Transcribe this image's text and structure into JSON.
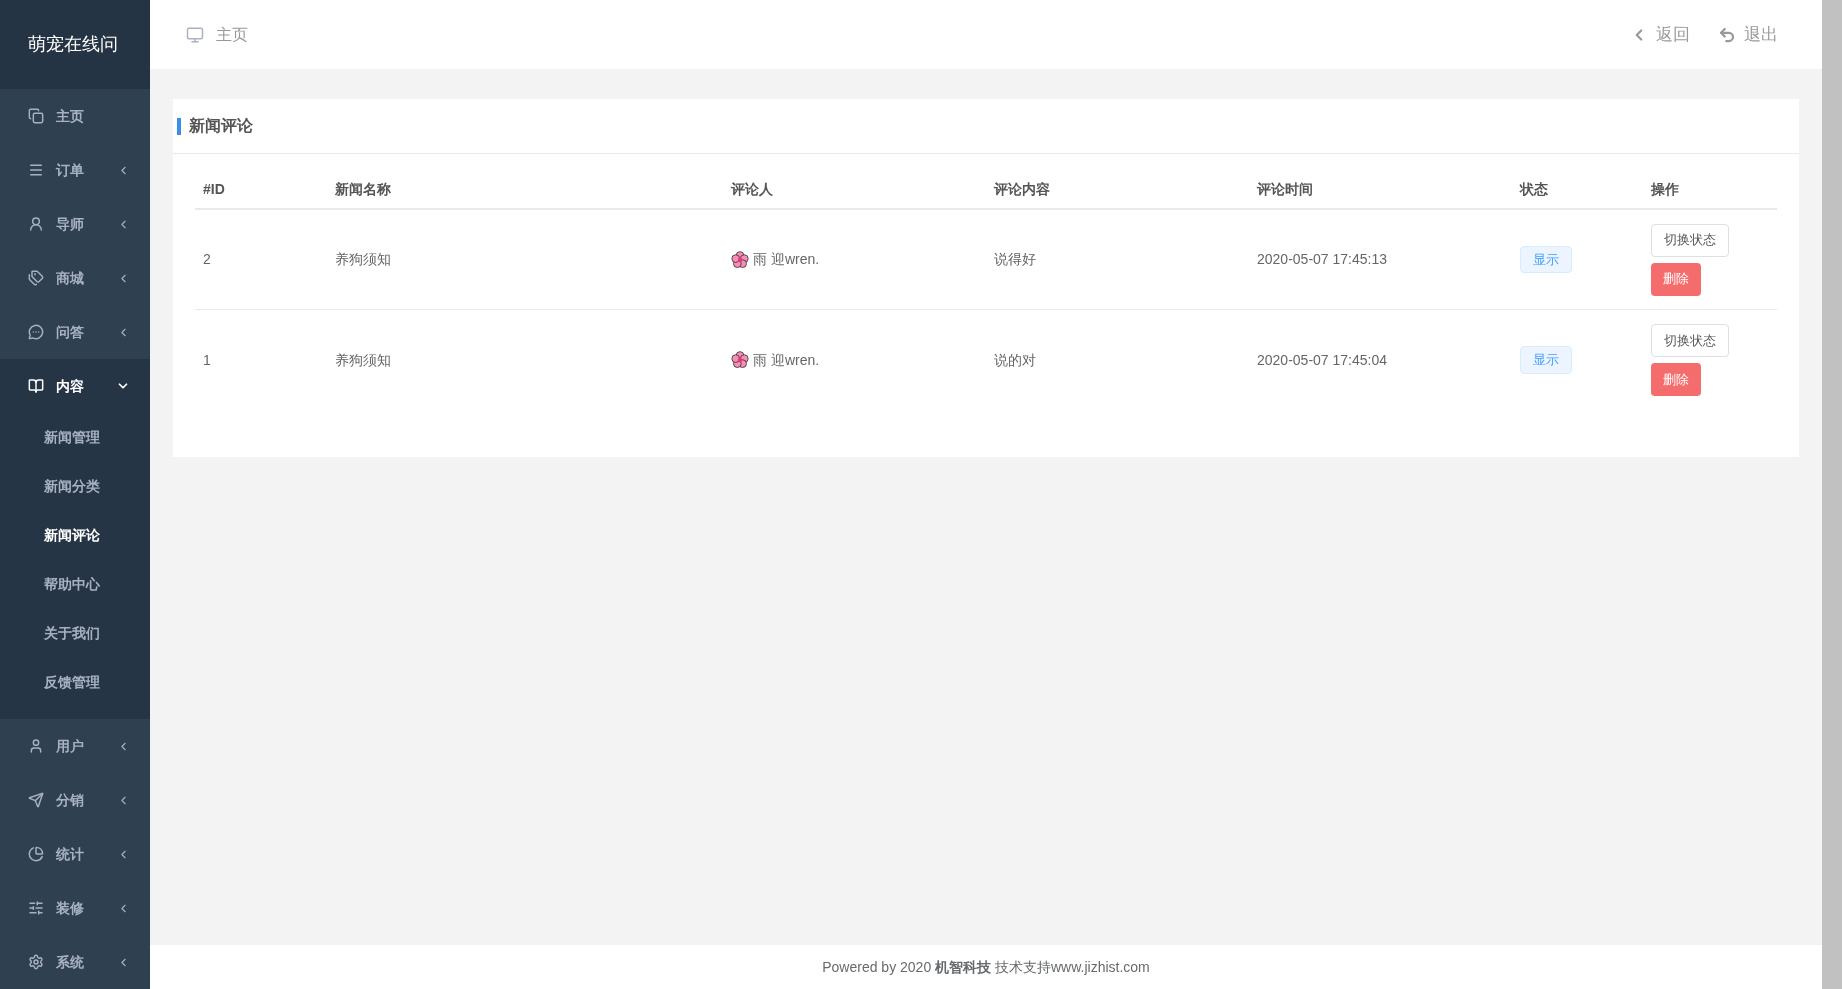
{
  "logo": "萌宠在线问",
  "sidebar": {
    "items": [
      {
        "label": "主页",
        "kind": "link"
      },
      {
        "label": "订单",
        "kind": "group",
        "expanded": false
      },
      {
        "label": "导师",
        "kind": "group",
        "expanded": false
      },
      {
        "label": "商城",
        "kind": "group",
        "expanded": false
      },
      {
        "label": "问答",
        "kind": "group",
        "expanded": false
      },
      {
        "label": "内容",
        "kind": "group",
        "expanded": true,
        "children": [
          {
            "label": "新闻管理",
            "selected": false
          },
          {
            "label": "新闻分类",
            "selected": false
          },
          {
            "label": "新闻评论",
            "selected": true
          },
          {
            "label": "帮助中心",
            "selected": false
          },
          {
            "label": "关于我们",
            "selected": false
          },
          {
            "label": "反馈管理",
            "selected": false
          }
        ]
      },
      {
        "label": "用户",
        "kind": "group",
        "expanded": false
      },
      {
        "label": "分销",
        "kind": "group",
        "expanded": false
      },
      {
        "label": "统计",
        "kind": "group",
        "expanded": false
      },
      {
        "label": "装修",
        "kind": "group",
        "expanded": false
      },
      {
        "label": "系统",
        "kind": "group",
        "expanded": false
      }
    ]
  },
  "header": {
    "breadcrumb": "主页",
    "back": "返回",
    "logout": "退出"
  },
  "card": {
    "title": "新闻评论",
    "table": {
      "columns": [
        "#ID",
        "新闻名称",
        "评论人",
        "评论内容",
        "评论时间",
        "状态",
        "操作"
      ],
      "rows": [
        {
          "id": "2",
          "news": "养狗须知",
          "commenter": "雨 迎wren.",
          "content": "说得好",
          "time": "2020-05-07 17:45:13",
          "status": "显示",
          "actions": [
            "切换状态",
            "删除"
          ]
        },
        {
          "id": "1",
          "news": "养狗须知",
          "commenter": "雨 迎wren.",
          "content": "说的对",
          "time": "2020-05-07 17:45:04",
          "status": "显示",
          "actions": [
            "切换状态",
            "删除"
          ]
        }
      ]
    }
  },
  "footer": "Powered by 2020 **机智科技** 技术支持www.jizhist.com"
}
